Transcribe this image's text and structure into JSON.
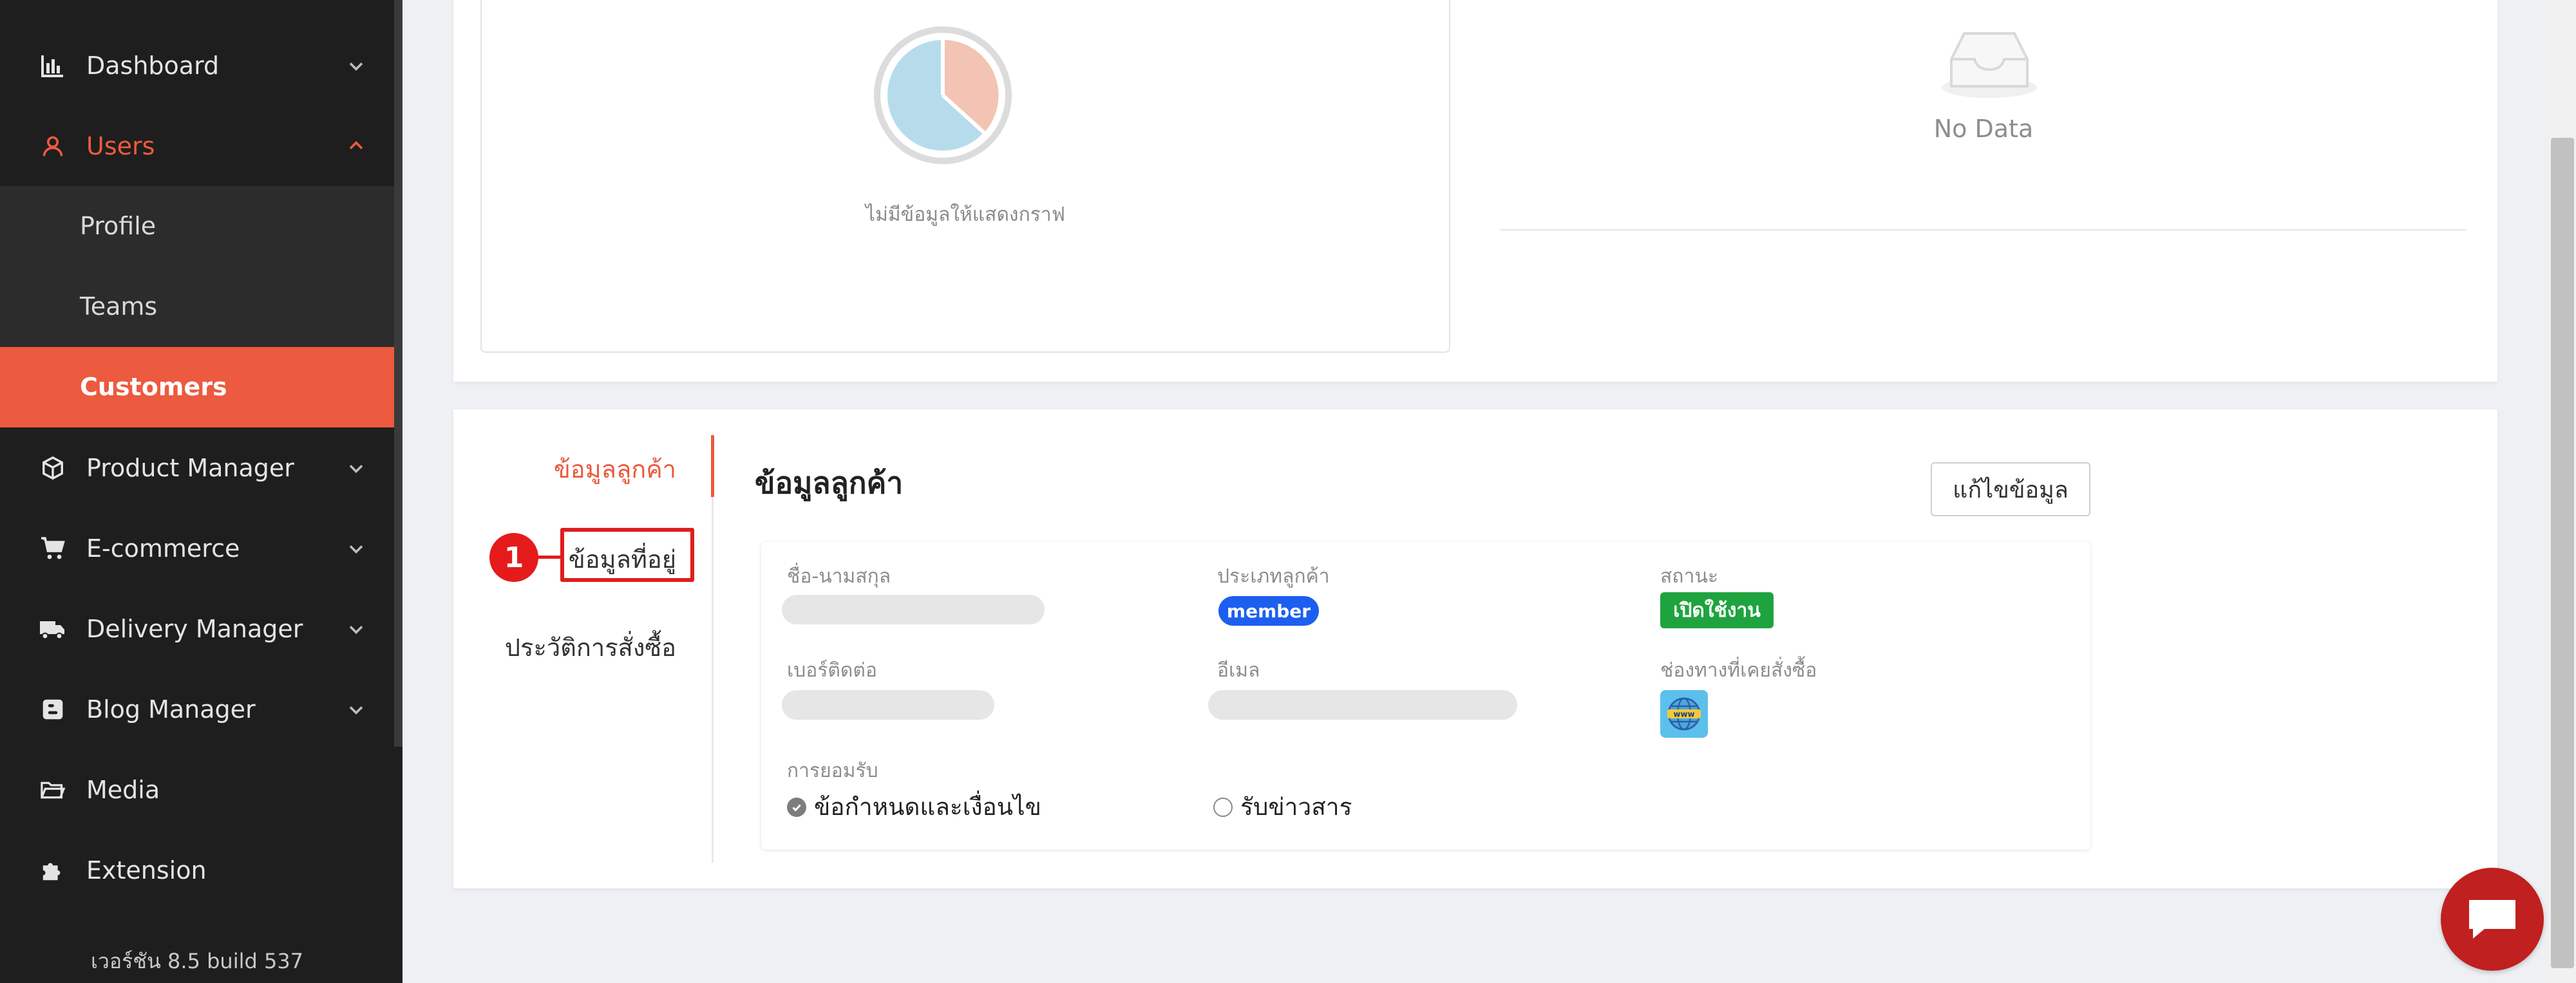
{
  "sidebar": {
    "items": [
      {
        "key": "dashboard",
        "label": "Dashboard",
        "icon": "bar-chart-icon",
        "expandable": true
      },
      {
        "key": "users",
        "label": "Users",
        "icon": "user-icon",
        "expandable": true,
        "active": true
      },
      {
        "key": "product-manager",
        "label": "Product Manager",
        "icon": "box-icon",
        "expandable": true
      },
      {
        "key": "e-commerce",
        "label": "E-commerce",
        "icon": "cart-icon",
        "expandable": true
      },
      {
        "key": "delivery-manager",
        "label": "Delivery Manager",
        "icon": "truck-icon",
        "expandable": true
      },
      {
        "key": "blog-manager",
        "label": "Blog Manager",
        "icon": "blogger-icon",
        "expandable": true
      },
      {
        "key": "media",
        "label": "Media",
        "icon": "folder-icon",
        "expandable": false
      },
      {
        "key": "extension",
        "label": "Extension",
        "icon": "puzzle-icon",
        "expandable": false
      }
    ],
    "users_submenu": [
      {
        "label": "Profile"
      },
      {
        "label": "Teams"
      },
      {
        "label": "Customers",
        "selected": true
      }
    ],
    "version": "เวอร์ชัน 8.5 build 537"
  },
  "top_panels": {
    "pie_empty_text": "ไม่มีข้อมูลให้แสดงกราฟ",
    "no_data_text": "No Data"
  },
  "customer": {
    "tabs": [
      {
        "label": "ข้อมูลลูกค้า",
        "active": true
      },
      {
        "label": "ข้อมูลที่อยู่"
      },
      {
        "label": "ประวัติการสั่งซื้อ"
      }
    ],
    "marker_number": "1",
    "section_title": "ข้อมูลลูกค้า",
    "edit_button": "แก้ไขข้อมูล",
    "fields": {
      "name_label": "ชื่อ-นามสกุล",
      "type_label": "ประเภทลูกค้า",
      "type_value": "member",
      "status_label": "สถานะ",
      "status_value": "เปิดใช้งาน",
      "phone_label": "เบอร์ติดต่อ",
      "email_label": "อีเมล",
      "channel_label": "ช่องทางที่เคยสั่งซื้อ",
      "channel_icon": "www-globe-icon",
      "consent_label": "การยอมรับ",
      "terms_label": "ข้อกำหนดและเงื่อนไข",
      "terms_checked": true,
      "newsletter_label": "รับข่าวสาร",
      "newsletter_checked": false
    }
  },
  "colors": {
    "accent": "#ec5a3f",
    "sidebar_bg": "#1e1e1e",
    "member_badge": "#1c5ff0",
    "status_badge": "#1fa33f",
    "chat_button": "#c0201f",
    "annotation_red": "#e01d1d"
  }
}
